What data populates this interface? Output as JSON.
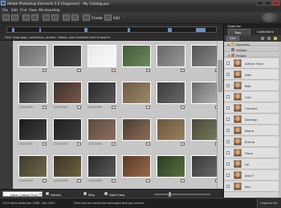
{
  "window": {
    "title": "Adobe Photoshop Elements 5.0 (Organizer) - My Catalog.psa"
  },
  "menu": [
    "File",
    "Edit",
    "Find",
    "View",
    "Window",
    "Help"
  ],
  "toolbar": {
    "create_label": "Create",
    "edit_label": "Edit"
  },
  "search": {
    "hint": "Find: Drag tags, collections, photos, videos, and creations here to search"
  },
  "photos": [
    {
      "caption": "",
      "colors": [
        "#6a6a6a",
        "#9a9a9a"
      ]
    },
    {
      "caption": "",
      "colors": [
        "#2a2a2a",
        "#4a4a4a"
      ]
    },
    {
      "caption": "",
      "colors": [
        "#e8e8e8",
        "#fafafa"
      ]
    },
    {
      "caption": "",
      "colors": [
        "#3f5a3c",
        "#6e8a5a"
      ]
    },
    {
      "caption": "",
      "colors": [
        "#666",
        "#999"
      ]
    },
    {
      "caption": "",
      "colors": [
        "#555",
        "#8a8a8a"
      ]
    },
    {
      "caption": "12/05/2006",
      "colors": [
        "#2b2b2b",
        "#6a6a6a"
      ]
    },
    {
      "caption": "12/05/2006",
      "colors": [
        "#3a2f2a",
        "#7a5a4a"
      ]
    },
    {
      "caption": "12/05/2006",
      "colors": [
        "#2a2a2a",
        "#585858"
      ]
    },
    {
      "caption": "",
      "colors": [
        "#6a5a45",
        "#a08868"
      ]
    },
    {
      "caption": "",
      "colors": [
        "#3a3a3a",
        "#6a6a6a"
      ]
    },
    {
      "caption": "",
      "colors": [
        "#6a6a6a",
        "#b0b0b0"
      ]
    },
    {
      "caption": "12/05/2006",
      "colors": [
        "#1a1a1a",
        "#404040"
      ]
    },
    {
      "caption": "12/05/2006",
      "colors": [
        "#1f1f1f",
        "#3d3d3d"
      ]
    },
    {
      "caption": "12/05/2006",
      "colors": [
        "#5b4a3c",
        "#8a7060"
      ]
    },
    {
      "caption": "",
      "colors": [
        "#4a3e34",
        "#8a6e58"
      ]
    },
    {
      "caption": "",
      "colors": [
        "#6b5640",
        "#9a8060"
      ]
    },
    {
      "caption": "",
      "colors": [
        "#4a4a3a",
        "#7a7a60"
      ]
    },
    {
      "caption": "12/05/2006",
      "colors": [
        "#3c3a2c",
        "#706a4a"
      ]
    },
    {
      "caption": "12/05/2006",
      "colors": [
        "#3a3426",
        "#6e6240"
      ]
    },
    {
      "caption": "12/05/2006",
      "colors": [
        "#2a2a2a",
        "#5a5a5a"
      ]
    },
    {
      "caption": "",
      "colors": [
        "#5a3a2a",
        "#9a6a4a"
      ]
    },
    {
      "caption": "",
      "colors": [
        "#2c3a22",
        "#5a7040"
      ]
    },
    {
      "caption": "",
      "colors": [
        "#3a3a3a",
        "#6a6a6a"
      ]
    }
  ],
  "panel": {
    "organize": "Organize",
    "tab_tags": "Tags",
    "tab_collections": "Collections",
    "new_label": "New",
    "categories": [
      "Favorites",
      "Hidden",
      "People"
    ],
    "people": [
      "Adrian Flora",
      "Alex",
      "Bob",
      "Carl",
      "Caroline",
      "Darragh",
      "Diane",
      "Emma",
      "Fiona",
      "Gil",
      "Jean F",
      "Ken"
    ]
  },
  "bottombar": {
    "sort": "Date (Oldest First)",
    "details": "Details",
    "map": "Map",
    "date_view": "Date View"
  },
  "status": {
    "left": "1515 items dated Jan 1986 - Dec 2007",
    "message": "Click here to control the messages that you receive",
    "right": "Organize Bin"
  }
}
